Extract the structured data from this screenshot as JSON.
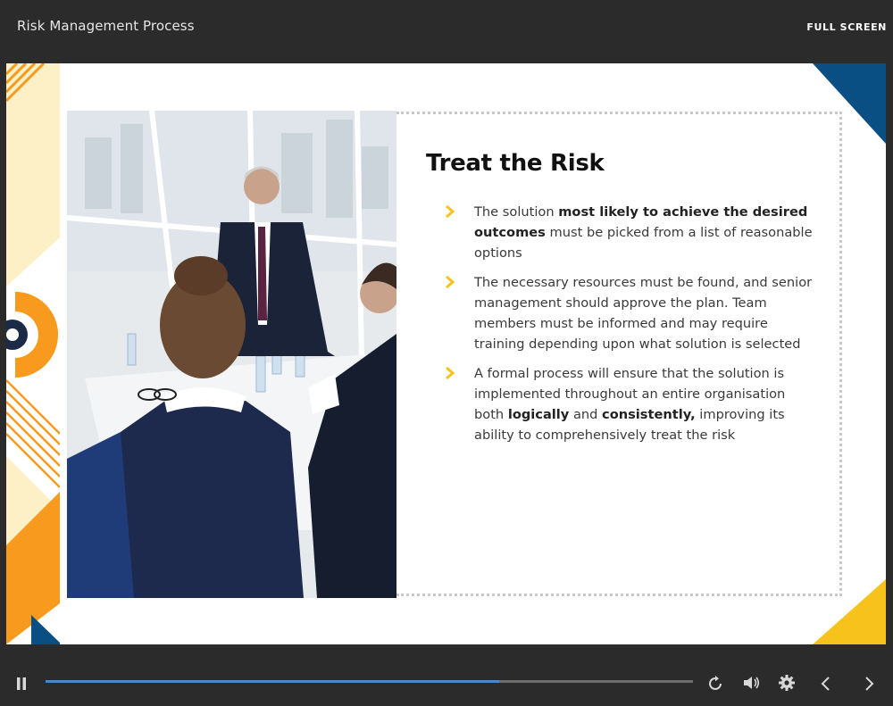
{
  "header": {
    "title": "Risk Management Process",
    "fullscreen_label": "FULL SCREEN"
  },
  "slide": {
    "heading": "Treat the Risk",
    "bullets": [
      {
        "parts": [
          {
            "text": "The solution ",
            "bold": false
          },
          {
            "text": "most likely to achieve the desired outcomes",
            "bold": true
          },
          {
            "text": " must be picked from a list of reasonable options",
            "bold": false
          }
        ]
      },
      {
        "parts": [
          {
            "text": "The necessary resources must be found, and senior management should approve the plan. Team members must be informed and may require training depending upon what solution is selected",
            "bold": false
          }
        ]
      },
      {
        "parts": [
          {
            "text": "A formal process will ensure that the solution is implemented throughout an entire organisation both ",
            "bold": false
          },
          {
            "text": "logically",
            "bold": true
          },
          {
            "text": " and ",
            "bold": false
          },
          {
            "text": "consistently,",
            "bold": true
          },
          {
            "text": " improving its ability to comprehensively treat the risk",
            "bold": false
          }
        ]
      }
    ],
    "photo_icon": "business-meeting-photo"
  },
  "player": {
    "progress": 0.7,
    "icons": {
      "pause": "pause-icon",
      "replay": "replay-icon",
      "volume": "volume-icon",
      "settings": "settings-icon",
      "prev": "chevron-left-icon",
      "next": "chevron-right-icon"
    }
  },
  "colors": {
    "accent_yellow": "#f6c21b",
    "accent_orange": "#f79a1e",
    "accent_blue": "#0a4f84",
    "navy": "#1b2a47",
    "progress": "#4d86c6"
  }
}
